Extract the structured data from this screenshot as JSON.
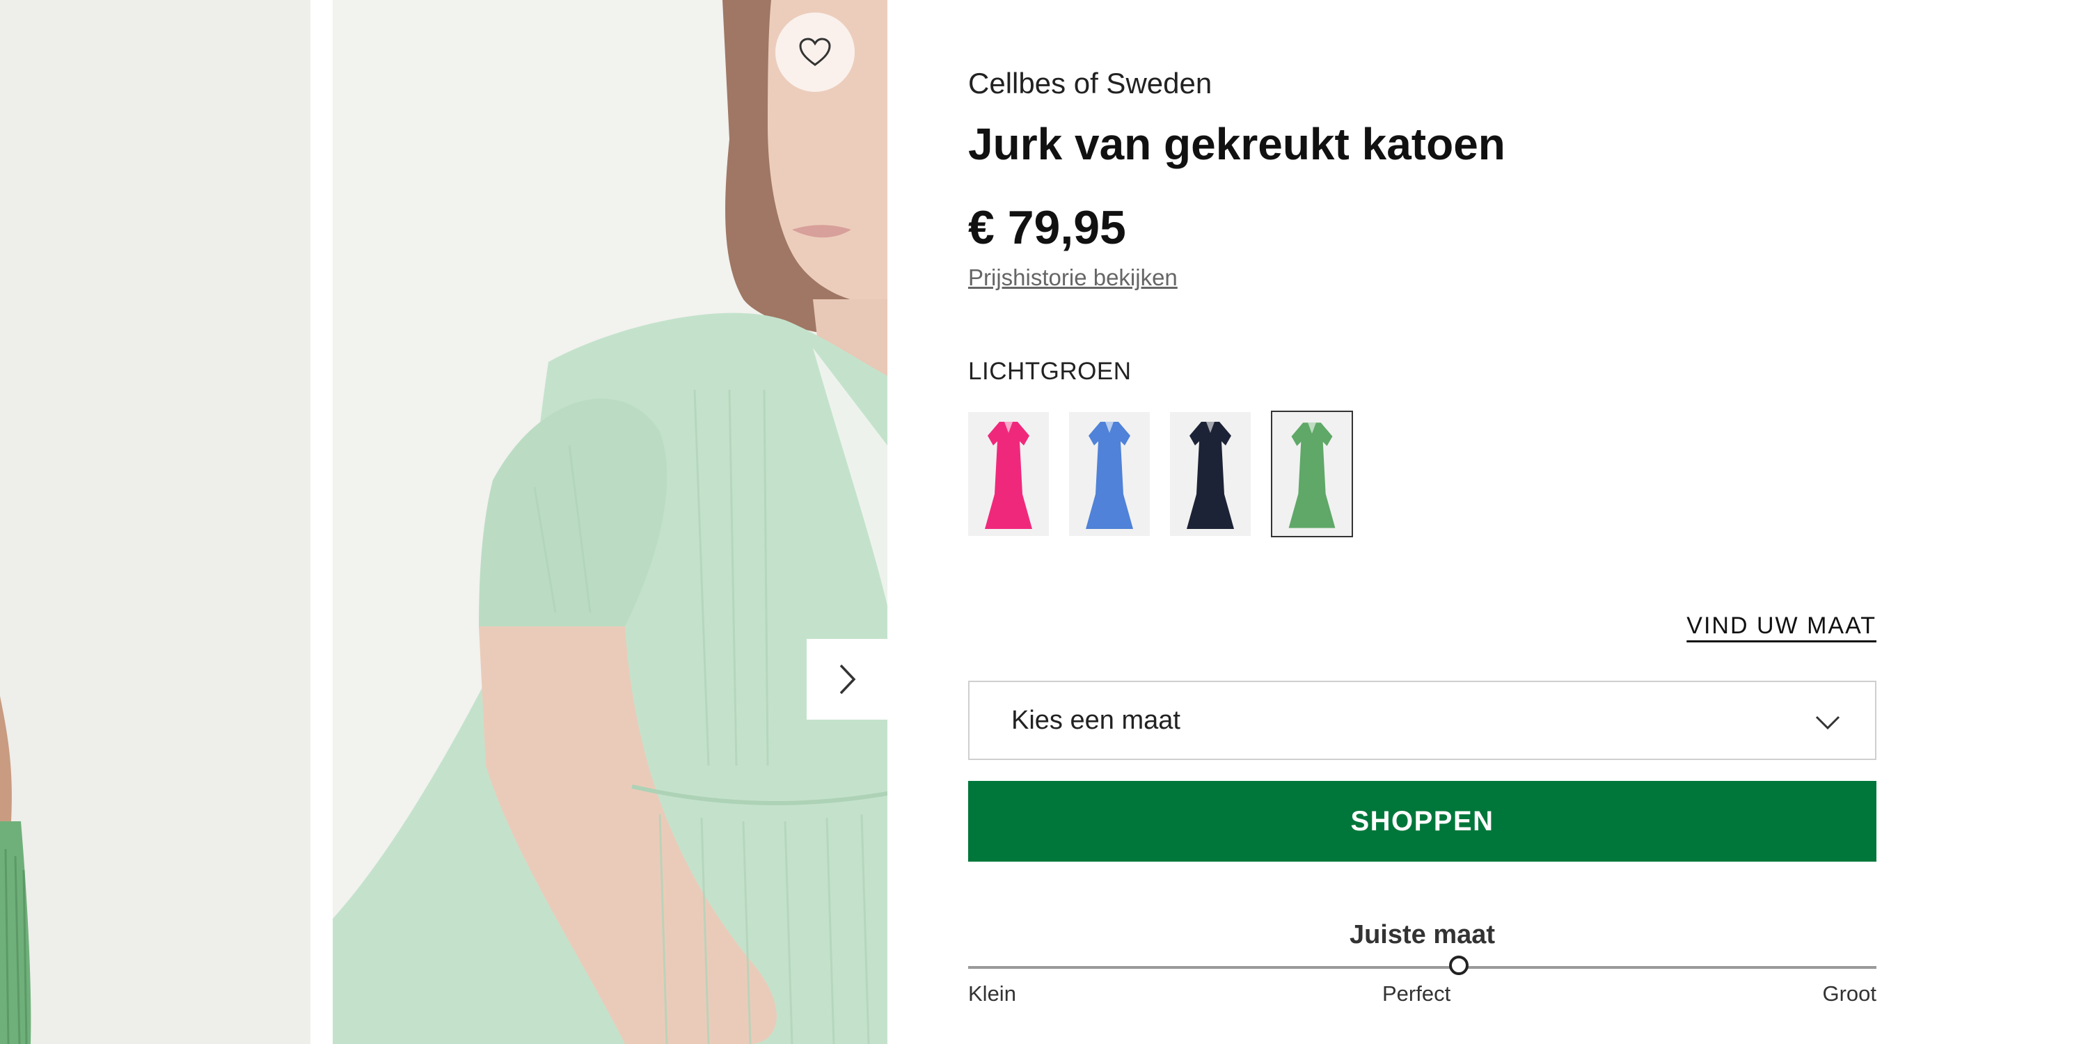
{
  "gallery": {
    "wishlist_icon": "heart-outline-icon",
    "next_icon": "chevron-right-icon"
  },
  "product": {
    "brand": "Cellbes of Sweden",
    "title": "Jurk van gekreukt katoen",
    "price": "€ 79,95",
    "price_history_link": "Prijshistorie bekijken"
  },
  "colors": {
    "selected_label": "LICHTGROEN",
    "swatches": [
      {
        "name": "pink",
        "color": "#f0287c",
        "selected": false
      },
      {
        "name": "blue",
        "color": "#4f82d8",
        "selected": false
      },
      {
        "name": "navy",
        "color": "#1d2336",
        "selected": false
      },
      {
        "name": "lichtgroen",
        "color": "#5fa868",
        "selected": true
      }
    ]
  },
  "size": {
    "guide_link": "VIND UW MAAT",
    "select_placeholder": "Kies een maat",
    "chevron_icon": "chevron-down-icon"
  },
  "cta": {
    "shop_label": "SHOPPEN",
    "color": "#00773a"
  },
  "fit": {
    "title": "Juiste maat",
    "labels": {
      "left": "Klein",
      "center": "Perfect",
      "right": "Groot"
    },
    "position": 0.54
  }
}
